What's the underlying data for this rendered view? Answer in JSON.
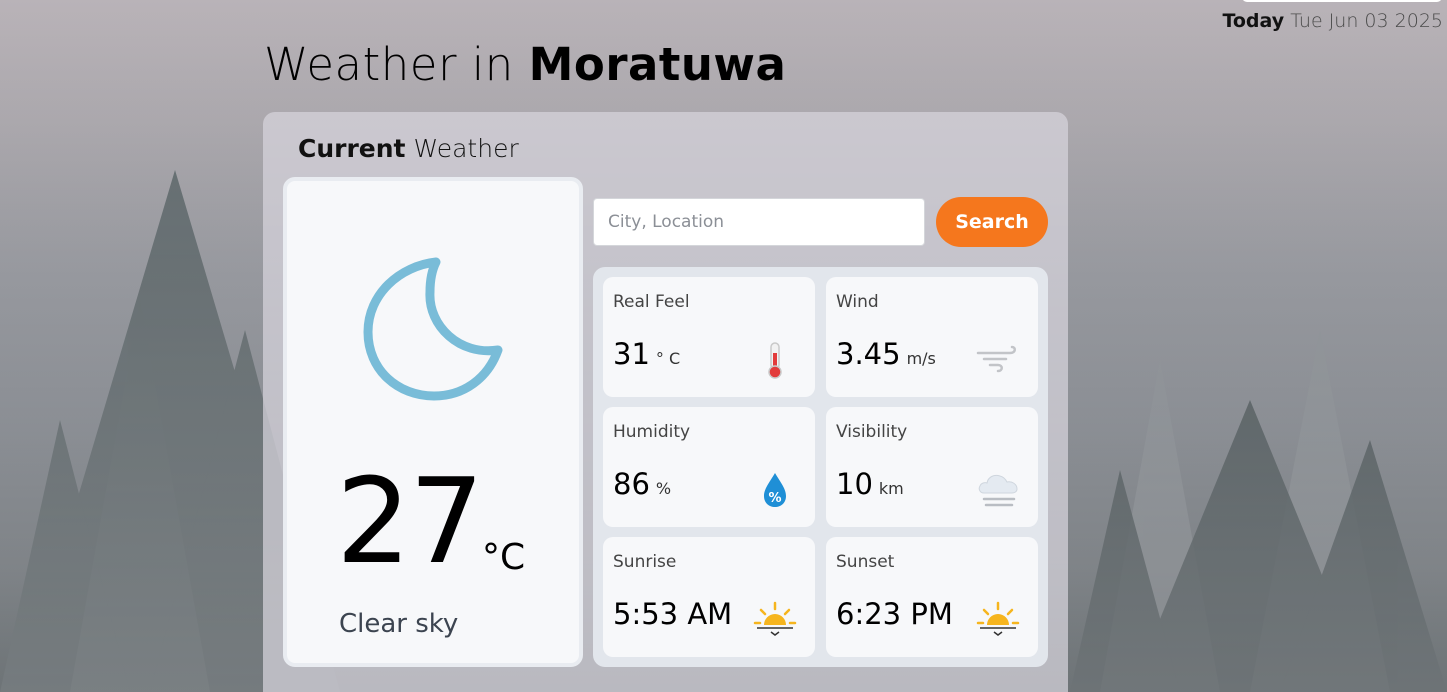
{
  "header": {
    "today_label": "Today",
    "date": "Tue Jun 03 2025",
    "title_prefix": "Weather in",
    "city": "Moratuwa"
  },
  "panel": {
    "heading_bold": "Current",
    "heading_rest": "Weather"
  },
  "current": {
    "temperature": "27",
    "unit": "°C",
    "condition": "Clear sky",
    "icon": "moon-icon"
  },
  "search": {
    "placeholder": "City, Location",
    "value": "",
    "button_label": "Search"
  },
  "details": [
    {
      "label": "Real Feel",
      "value": "31",
      "unit": "° C",
      "icon": "thermometer-icon"
    },
    {
      "label": "Wind",
      "value": "3.45",
      "unit": "m/s",
      "icon": "wind-icon"
    },
    {
      "label": "Humidity",
      "value": "86",
      "unit": "%",
      "icon": "humidity-drop-icon"
    },
    {
      "label": "Visibility",
      "value": "10",
      "unit": "km",
      "icon": "fog-cloud-icon"
    },
    {
      "label": "Sunrise",
      "value": "5:53 AM",
      "unit": "",
      "icon": "sunrise-icon"
    },
    {
      "label": "Sunset",
      "value": "6:23 PM",
      "unit": "",
      "icon": "sunset-icon"
    }
  ],
  "colors": {
    "accent": "#f5771d",
    "moon": "#79bcd8"
  }
}
